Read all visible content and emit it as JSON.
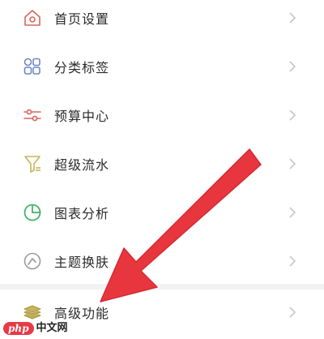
{
  "menu": {
    "items": [
      {
        "label": "首页设置",
        "icon": "home-gear-icon"
      },
      {
        "label": "分类标签",
        "icon": "category-grid-icon"
      },
      {
        "label": "预算中心",
        "icon": "sliders-icon"
      },
      {
        "label": "超级流水",
        "icon": "funnel-icon"
      },
      {
        "label": "图表分析",
        "icon": "pie-chart-icon"
      },
      {
        "label": "主题换肤",
        "icon": "palette-icon"
      },
      {
        "label": "高级功能",
        "icon": "stack-layers-icon"
      }
    ]
  },
  "annotation": {
    "arrow_color": "#e8363f",
    "arrow_icon": "red-arrow-pointer"
  },
  "watermark": {
    "logo": "php",
    "text": "中文网"
  },
  "colors": {
    "icon_red": "#d9665c",
    "icon_blue": "#6d86c9",
    "icon_green": "#45b36b",
    "icon_yellow": "#c8b45a",
    "chevron": "#c7c7c7",
    "label": "#2b2b2b"
  }
}
